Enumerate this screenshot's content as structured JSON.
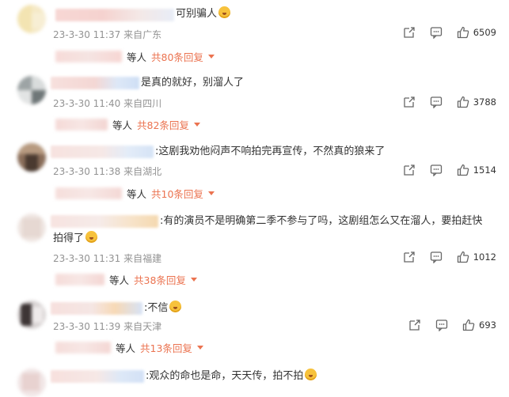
{
  "comments": [
    {
      "text": "可别骗人",
      "time": "23-3-30 11:37",
      "location": "来自广东",
      "likes": "6509",
      "reply_prefix": "等人",
      "reply_count": "共80条回复"
    },
    {
      "text": "是真的就好，别溜人了",
      "time": "23-3-30 11:40",
      "location": "来自四川",
      "likes": "3788",
      "reply_prefix": "等人",
      "reply_count": "共82条回复"
    },
    {
      "text": ":这剧我劝他闷声不响拍完再宣传，不然真的狼来了",
      "time": "23-3-30 11:38",
      "location": "来自湖北",
      "likes": "1514",
      "reply_prefix": "等人",
      "reply_count": "共10条回复"
    },
    {
      "text_line1": ":有的演员不是明确第二季不参与了吗，这剧组怎么又在溜人，要拍赶快",
      "text_line2": "拍得了",
      "time": "23-3-30 11:31",
      "location": "来自福建",
      "likes": "1012",
      "reply_prefix": "等人",
      "reply_count": "共38条回复"
    },
    {
      "text": ":不信",
      "time": "23-3-30 11:39",
      "location": "来自天津",
      "likes": "693",
      "reply_prefix": "等人",
      "reply_count": "共13条回复"
    },
    {
      "text": ":观众的命也是命，天天传，拍不拍"
    }
  ],
  "colors": {
    "reply_link": "#eb7350",
    "meta": "#939393",
    "emoji": "#f7c23c"
  },
  "icons": {
    "share": "share-icon",
    "comment": "comment-icon",
    "like": "thumbs-up-icon"
  }
}
